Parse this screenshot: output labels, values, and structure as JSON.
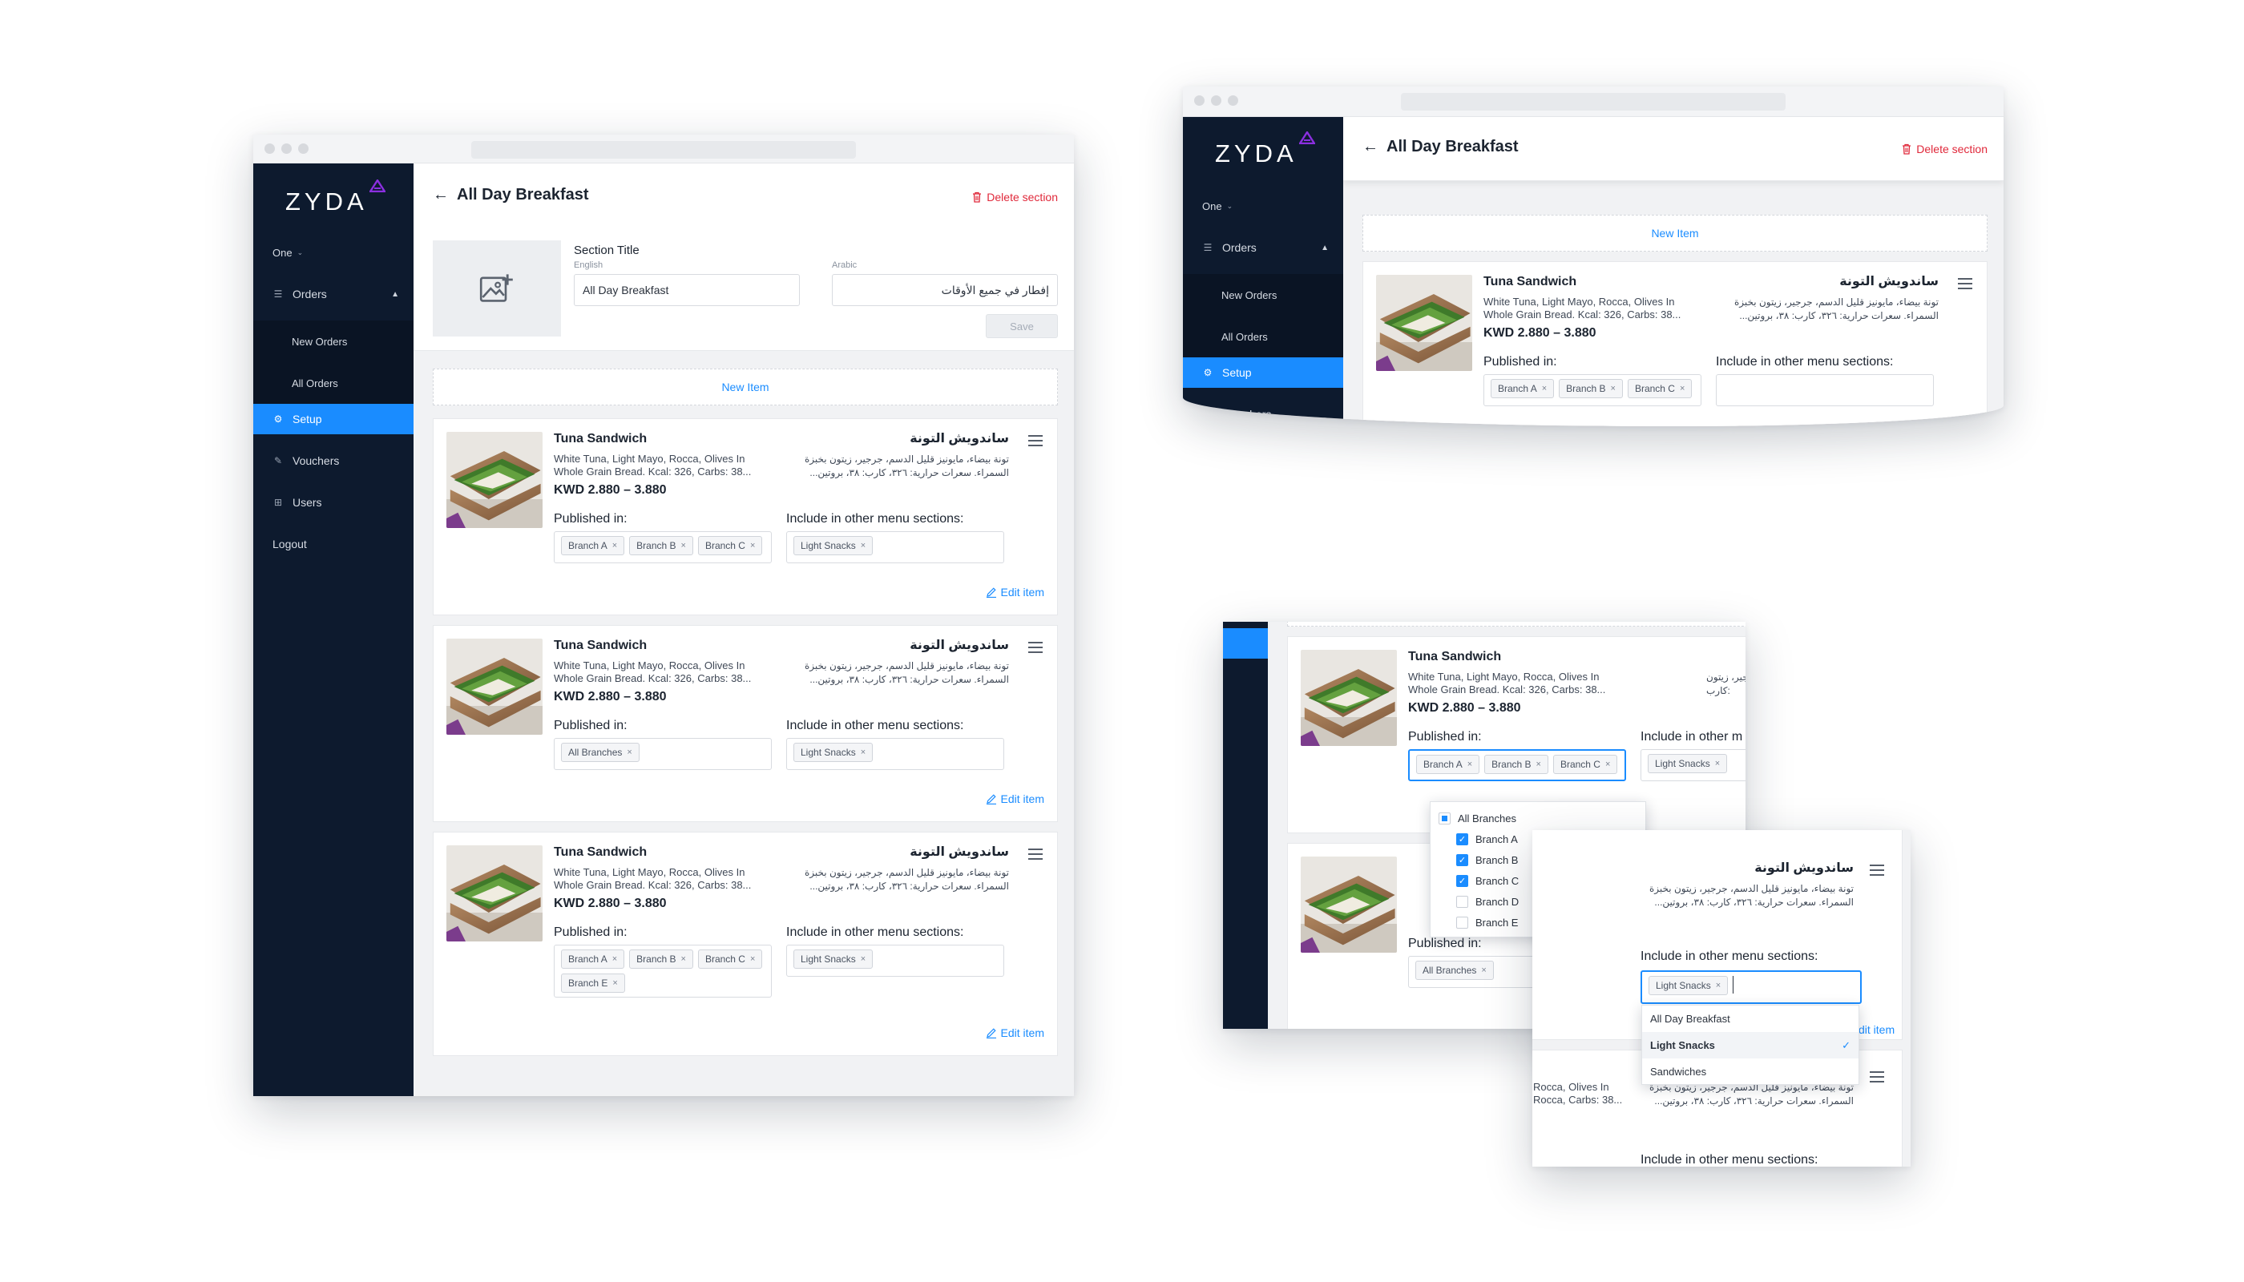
{
  "brand": {
    "logo_text": "ZYDA",
    "accent": "#1a8cff",
    "sidebar_bg": "#0d1a2e",
    "logo_mark_color": "#8b2fe0",
    "danger": "#e0283a"
  },
  "sidebar": {
    "store": "One",
    "items": [
      {
        "label": "Orders",
        "icon": "list-icon"
      },
      {
        "label": "New Orders"
      },
      {
        "label": "All Orders"
      },
      {
        "label": "Setup",
        "icon": "gear-icon"
      },
      {
        "label": "Vouchers",
        "icon": "tag-icon"
      },
      {
        "label": "Users",
        "icon": "users-icon"
      },
      {
        "label": "Logout"
      }
    ],
    "cut_item": "Vouchers"
  },
  "header": {
    "title": "All Day Breakfast",
    "delete_label": "Delete section"
  },
  "section_form": {
    "title_label": "Section Title",
    "english_label": "English",
    "english_value": "All Day Breakfast",
    "arabic_label": "Arabic",
    "arabic_value": "إفطار في جميع الأوقات",
    "save_label": "Save"
  },
  "new_item_label": "New Item",
  "item": {
    "name": "Tuna Sandwich",
    "name_ar": "ساندويش التونة",
    "desc_line1": "White Tuna, Light Mayo, Rocca, Olives In",
    "desc_line2": "Whole Grain Bread. Kcal: 326, Carbs: 38...",
    "desc_ar_line1": "تونة بيضاء، مايونيز قليل الدسم، جرجير، زيتون بخبزة",
    "desc_ar_line2": "السمراء. سعرات حرارية: ٣٢٦، كارب: ٣٨، بروتين...",
    "price": "KWD 2.880 – 3.880",
    "published_label": "Published in:",
    "include_label": "Include in other menu sections:",
    "include_cut_label": "Include in other m",
    "edit_label": "Edit item",
    "edit_cut_label": "dit item"
  },
  "tags": {
    "branch_a": "Branch A",
    "branch_b": "Branch B",
    "branch_c": "Branch C",
    "branch_e": "Branch E",
    "all_branches": "All Branches",
    "light_snacks": "Light Snacks"
  },
  "branch_dropdown": {
    "options": [
      "All Branches",
      "Branch A",
      "Branch B",
      "Branch C",
      "Branch D",
      "Branch E"
    ]
  },
  "section_dropdown": {
    "options": [
      "All Day Breakfast",
      "Light Snacks",
      "Sandwiches"
    ],
    "selected": "Light Snacks"
  },
  "fragments": {
    "desc_cut1": "Rocca, Olives In",
    "desc_cut2": "Rocca, Carbs: 38...",
    "ar_cut1": "جرجير، زيتون",
    "ar_cut2": "كارب:"
  }
}
